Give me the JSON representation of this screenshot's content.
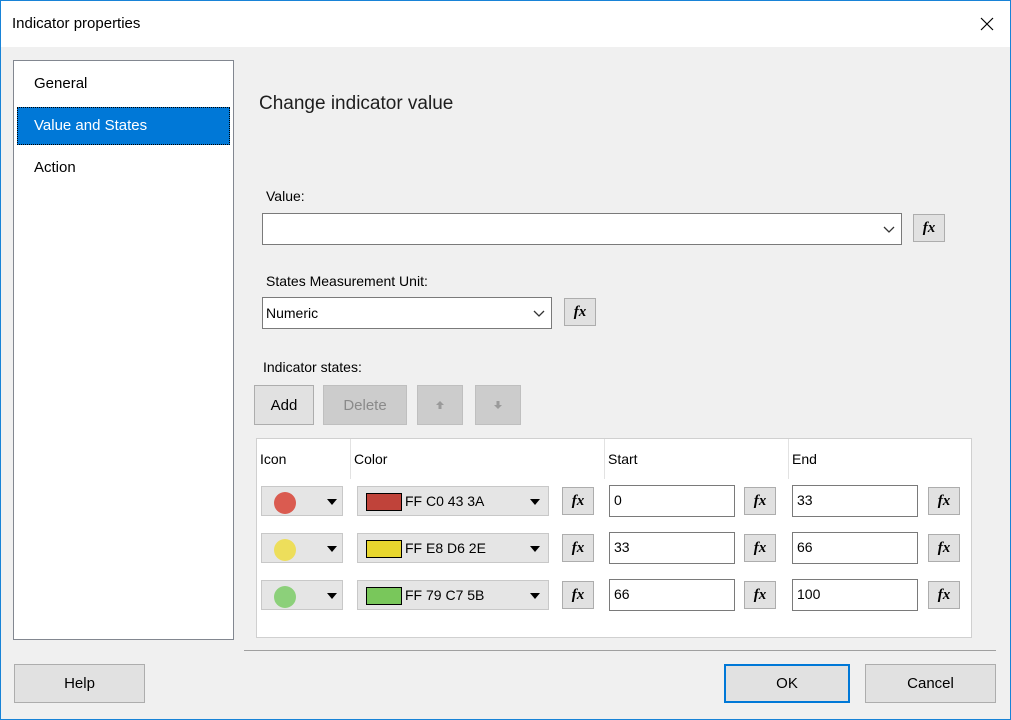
{
  "window": {
    "title": "Indicator properties"
  },
  "sidebar": {
    "items": [
      {
        "label": "General",
        "selected": false
      },
      {
        "label": "Value and States",
        "selected": true
      },
      {
        "label": "Action",
        "selected": false
      }
    ]
  },
  "main": {
    "heading": "Change indicator value",
    "value_label": "Value:",
    "value_input": "",
    "unit_label": "States Measurement Unit:",
    "unit_value": "Numeric",
    "states_label": "Indicator states:",
    "buttons": {
      "add": "Add",
      "delete": "Delete"
    },
    "fx": "fx"
  },
  "grid": {
    "headers": [
      "Icon",
      "Color",
      "Start",
      "End"
    ],
    "rows": [
      {
        "dot_color": "#DA5B50",
        "swatch_color": "#C0433A",
        "color_text": "FF C0 43 3A",
        "start": "0",
        "end": "33"
      },
      {
        "dot_color": "#EDDE5B",
        "swatch_color": "#E8D62E",
        "color_text": "FF E8 D6 2E",
        "start": "33",
        "end": "66"
      },
      {
        "dot_color": "#8CD07A",
        "swatch_color": "#79C75B",
        "color_text": "FF 79 C7 5B",
        "start": "66",
        "end": "100"
      }
    ]
  },
  "footer": {
    "help": "Help",
    "ok": "OK",
    "cancel": "Cancel"
  },
  "colors": {
    "accent": "#0078D7"
  }
}
